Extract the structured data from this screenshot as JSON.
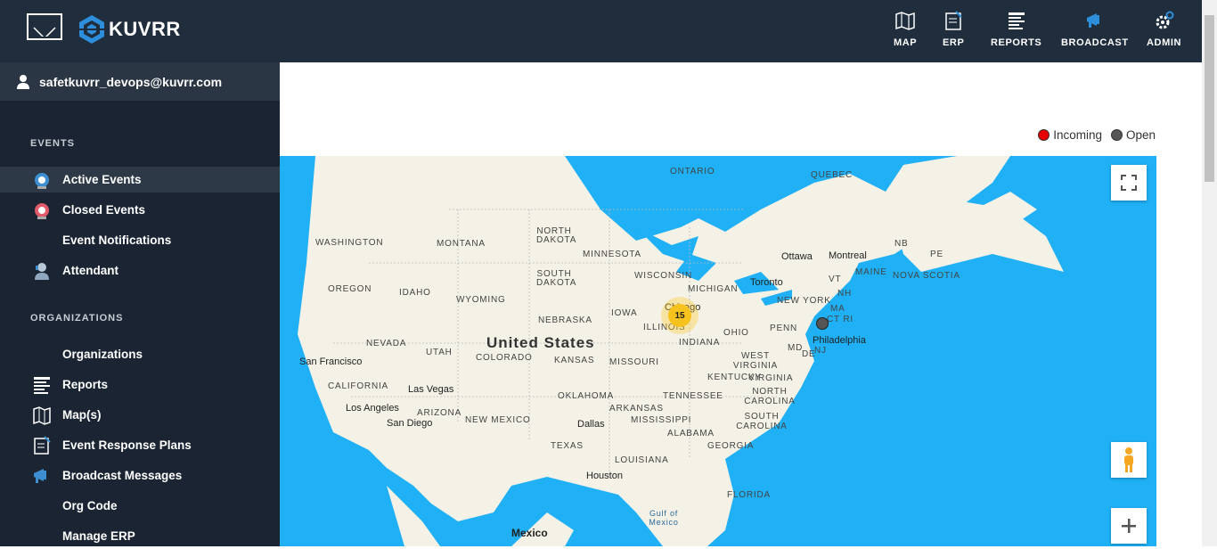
{
  "header": {
    "brand": "KUVRR",
    "nav": [
      {
        "label": "MAP",
        "icon": "map-icon"
      },
      {
        "label": "ERP",
        "icon": "erp-icon"
      },
      {
        "label": "REPORTS",
        "icon": "reports-icon"
      },
      {
        "label": "BROADCAST",
        "icon": "broadcast-icon"
      },
      {
        "label": "ADMIN",
        "icon": "admin-gear-icon"
      }
    ]
  },
  "sidebar": {
    "user": "safetkuvrr_devops@kuvrr.com",
    "sections": [
      {
        "title": "EVENTS",
        "items": [
          {
            "label": "Active Events",
            "icon": "alarm-icon",
            "active": true
          },
          {
            "label": "Closed Events",
            "icon": "alarm-icon"
          },
          {
            "label": "Event Notifications"
          },
          {
            "label": "Attendant",
            "icon": "attendant-icon"
          }
        ]
      },
      {
        "title": "ORGANIZATIONS",
        "items": [
          {
            "label": "Organizations"
          },
          {
            "label": "Reports",
            "icon": "reports-icon"
          },
          {
            "label": "Map(s)",
            "icon": "map-icon"
          },
          {
            "label": "Event Response Plans",
            "icon": "erp-icon"
          },
          {
            "label": "Broadcast Messages",
            "icon": "broadcast-icon"
          },
          {
            "label": "Org Code"
          },
          {
            "label": "Manage ERP"
          }
        ]
      }
    ]
  },
  "legend": {
    "incoming": "Incoming",
    "open": "Open",
    "incoming_color": "#e60000",
    "open_color": "#555555"
  },
  "map": {
    "country": "United States",
    "labels": [
      "ONTARIO",
      "QUEBEC",
      "WASHINGTON",
      "MONTANA",
      "NORTH DAKOTA",
      "MINNESOTA",
      "WISCONSIN",
      "MICHIGAN",
      "SOUTH DAKOTA",
      "OREGON",
      "IDAHO",
      "WYOMING",
      "NEBRASKA",
      "IOWA",
      "ILLINOIS",
      "INDIANA",
      "OHIO",
      "NEW YORK",
      "PENN",
      "NEVADA",
      "UTAH",
      "COLORADO",
      "KANSAS",
      "MISSOURI",
      "CALIFORNIA",
      "ARIZONA",
      "NEW MEXICO",
      "OKLAHOMA",
      "ARKANSAS",
      "TENNESSEE",
      "KENTUCKY",
      "WEST VIRGINIA",
      "VIRGINIA",
      "NORTH CAROLINA",
      "SOUTH CAROLINA",
      "MISSISSIPPI",
      "ALABAMA",
      "GEORGIA",
      "LOUISIANA",
      "TEXAS",
      "FLORIDA",
      "NB",
      "PE",
      "MAINE",
      "NOVA SCOTIA",
      "VT",
      "NH",
      "MA",
      "CT RI",
      "MD",
      "DE",
      "NJ",
      "Gulf of Mexico"
    ],
    "cities": [
      "Ottawa",
      "Montreal",
      "Toronto",
      "Chicago",
      "Philadelphia",
      "San Francisco",
      "Las Vegas",
      "Los Angeles",
      "San Diego",
      "Dallas",
      "Houston",
      "Mexico"
    ],
    "cluster_count": "15"
  }
}
